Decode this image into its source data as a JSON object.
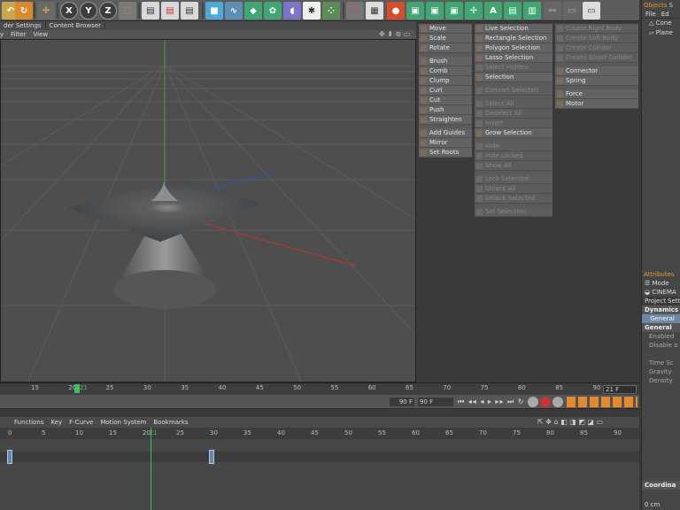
{
  "tabs": [
    "der Settings",
    "Content Browser"
  ],
  "viewport_menu": [
    "y",
    "Filter",
    "View"
  ],
  "menu_col1": [
    {
      "label": "Move",
      "dis": false
    },
    {
      "label": "Scale",
      "dis": false
    },
    {
      "label": "Rotate",
      "dis": false
    },
    {
      "gap": true
    },
    {
      "label": "Brush",
      "dis": false
    },
    {
      "label": "Comb",
      "dis": false
    },
    {
      "label": "Clump",
      "dis": false
    },
    {
      "label": "Curl",
      "dis": false
    },
    {
      "label": "Cut",
      "dis": false
    },
    {
      "label": "Push",
      "dis": false
    },
    {
      "label": "Straighten",
      "dis": false
    },
    {
      "gap": true
    },
    {
      "label": "Add Guides",
      "dis": false
    },
    {
      "label": "Mirror",
      "dis": false
    },
    {
      "label": "Set Roots",
      "dis": false
    }
  ],
  "menu_col2": [
    {
      "label": "Live Selection",
      "dis": false
    },
    {
      "label": "Rectangle Selection",
      "dis": false
    },
    {
      "label": "Polygon Selection",
      "dis": false
    },
    {
      "label": "Lasso Selection",
      "dis": false
    },
    {
      "label": "Select Hidden",
      "dis": true
    },
    {
      "label": "Selection",
      "dis": false
    },
    {
      "gap": true
    },
    {
      "label": "Convert Selected",
      "dis": true
    },
    {
      "gap": true
    },
    {
      "label": "Select All",
      "dis": true
    },
    {
      "label": "Deselect All",
      "dis": true
    },
    {
      "label": "Invert",
      "dis": true
    },
    {
      "label": "Grow Selection",
      "dis": false
    },
    {
      "gap": true
    },
    {
      "label": "Hide",
      "dis": true
    },
    {
      "label": "Hide Locked",
      "dis": true
    },
    {
      "label": "Show All",
      "dis": true
    },
    {
      "gap": true
    },
    {
      "label": "Lock Selected",
      "dis": true
    },
    {
      "label": "Unlock All",
      "dis": true
    },
    {
      "label": "Unlock Selected",
      "dis": true
    },
    {
      "gap": true
    },
    {
      "label": "Set Selection",
      "dis": true
    }
  ],
  "menu_col3": [
    {
      "label": "Create Rigid Body",
      "dis": true
    },
    {
      "label": "Create Soft Body",
      "dis": true
    },
    {
      "label": "Create Collider",
      "dis": true
    },
    {
      "label": "Create Ghost Collider",
      "dis": true
    },
    {
      "gap": true
    },
    {
      "label": "Connector",
      "dis": false
    },
    {
      "label": "Spring",
      "dis": false
    },
    {
      "gap": true
    },
    {
      "label": "Force",
      "dis": false
    },
    {
      "label": "Motor",
      "dis": false
    }
  ],
  "objects": {
    "tab1": "Objects",
    "tab2": "S",
    "menu": [
      "File",
      "Ed"
    ],
    "rows": [
      "Cone",
      "Plane"
    ]
  },
  "attributes": {
    "tab": "Attributes",
    "mode": "Mode",
    "obj": "CINEMA",
    "proj": "Project Sett",
    "dyn": "Dynamics",
    "general_btn": "General",
    "general_hdr": "General",
    "rows": [
      "Enabled",
      "Disable o",
      "",
      "Time Sc",
      "Gravity",
      "Density"
    ],
    "coord": "Coordina",
    "coord_val": "0 cm"
  },
  "ruler_ticks": [
    "15",
    "20",
    "25",
    "30",
    "35",
    "40",
    "45",
    "50",
    "55",
    "60",
    "65",
    "70",
    "75",
    "80",
    "85",
    "90"
  ],
  "current_frame_label": "21",
  "frame_box": "21 F",
  "transport": {
    "end_a": "90 F",
    "end_b": "90 F"
  },
  "timeline_menu": [
    "Functions",
    "Key",
    "F-Curve",
    "Motion System",
    "Bookmarks"
  ],
  "tl_ticks": [
    "0",
    "5",
    "10",
    "15",
    "20",
    "21",
    "25",
    "30",
    "35",
    "40",
    "45",
    "50",
    "55",
    "60",
    "65",
    "70",
    "75",
    "80",
    "85",
    "90"
  ],
  "colors": {
    "accent": "#e29b35",
    "selected": "#6b87a6",
    "axis_x": "#c03030",
    "axis_y": "#2fa84a",
    "axis_z": "#3050c0"
  }
}
